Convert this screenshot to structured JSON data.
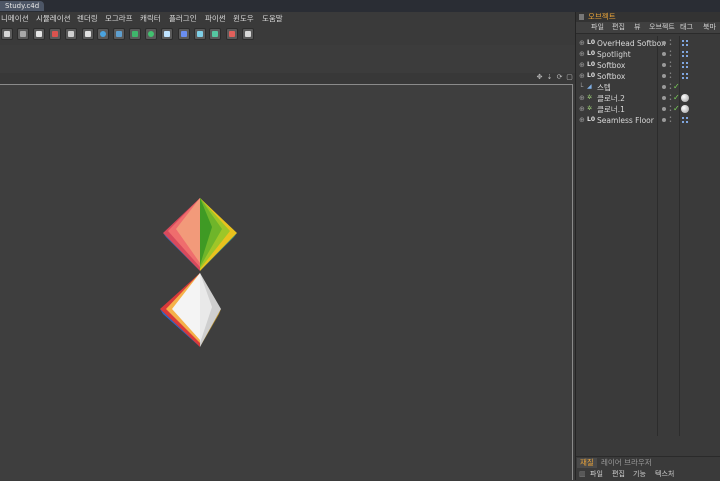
{
  "window": {
    "title": "Study.c4d"
  },
  "menu": [
    "니메이션",
    "시뮬레이션",
    "렌더링",
    "모그라프",
    "캐릭터",
    "플러그인",
    "파이썬",
    "윈도우",
    "도움말"
  ],
  "toolbar_icons": [
    "clapper-icon",
    "film-icon",
    "render-icon",
    "render-region-icon",
    "render-settings-icon",
    "null-object-icon",
    "sphere-icon",
    "cube-gear-icon",
    "subdivision-icon",
    "cloner-icon",
    "particle-icon",
    "spline-icon",
    "deformer-icon",
    "effector-icon",
    "camera-icon",
    "light-icon"
  ],
  "object_manager": {
    "title": "오브젝트",
    "menu": [
      "파일",
      "편집",
      "뷰",
      "오브젝트",
      "태그",
      "북마"
    ],
    "objects": [
      {
        "name": "OverHead Softbox",
        "icon": "L0",
        "type": "light"
      },
      {
        "name": "Spotlight",
        "icon": "L0",
        "type": "light"
      },
      {
        "name": "Softbox",
        "icon": "L0",
        "type": "light"
      },
      {
        "name": "Softbox",
        "icon": "L0",
        "type": "light"
      },
      {
        "name": "스텝",
        "icon": "stage",
        "type": "stage"
      },
      {
        "name": "클로너.2",
        "icon": "cloner",
        "type": "cloner"
      },
      {
        "name": "클로너.1",
        "icon": "cloner",
        "type": "cloner"
      },
      {
        "name": "Seamless Floor",
        "icon": "L0",
        "type": "light"
      }
    ]
  },
  "attribute_tabs": [
    "재질",
    "레이어 브라우저"
  ],
  "attribute_menu": [
    "파일",
    "편집",
    "기능",
    "텍스처"
  ],
  "colors": {
    "accent": "#e8a33a",
    "viewport": "#3e3e3e"
  }
}
